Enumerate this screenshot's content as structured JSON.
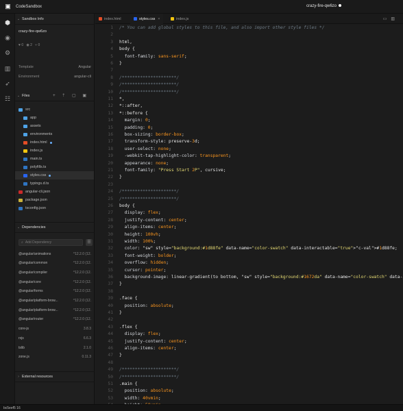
{
  "topbar": {
    "brand": "CodeSandbox",
    "sandbox_name": "crazy-fire-qw6zo"
  },
  "sidebar": {
    "info_header": "Sandbox Info",
    "sandbox_name": "crazy-fire-qw6zo",
    "stats": {
      "likes": "0",
      "views": "2",
      "forks": "0"
    },
    "template_label": "Template",
    "template_value": "Angular",
    "environment_label": "Environment",
    "environment_value": "angular-cli",
    "files_header": "Files",
    "files": [
      {
        "name": "src",
        "type": "folder"
      },
      {
        "name": "app",
        "type": "folder"
      },
      {
        "name": "assets",
        "type": "folder"
      },
      {
        "name": "environments",
        "type": "folder"
      },
      {
        "name": "index.html",
        "type": "html"
      },
      {
        "name": "index.js",
        "type": "js"
      },
      {
        "name": "main.ts",
        "type": "ts"
      },
      {
        "name": "polyfills.ts",
        "type": "ts"
      },
      {
        "name": "styles.css",
        "type": "css"
      },
      {
        "name": "typings.d.ts",
        "type": "ts"
      },
      {
        "name": "angular-cli.json",
        "type": "angular"
      },
      {
        "name": "package.json",
        "type": "json"
      },
      {
        "name": "tsconfig.json",
        "type": "ts"
      }
    ],
    "deps_header": "Dependencies",
    "add_dep_placeholder": "Add Dependency",
    "dependencies": [
      {
        "name": "@angular/animations",
        "version": "^12.2.0 (12."
      },
      {
        "name": "@angular/common",
        "version": "^12.2.0 (12."
      },
      {
        "name": "@angular/compiler",
        "version": "^12.2.0 (12."
      },
      {
        "name": "@angular/core",
        "version": "^12.2.0 (12."
      },
      {
        "name": "@angular/forms",
        "version": "^12.2.0 (12."
      },
      {
        "name": "@angular/platform-brow...",
        "version": "^12.2.0 (12."
      },
      {
        "name": "@angular/platform-brow...",
        "version": "^12.2.0 (12."
      },
      {
        "name": "@angular/router",
        "version": "^12.2.0 (12."
      },
      {
        "name": "core-js",
        "version": "3.8.3"
      },
      {
        "name": "rxjs",
        "version": "6.6.3"
      },
      {
        "name": "tslib",
        "version": "2.1.0"
      },
      {
        "name": "zone.js",
        "version": "0.11.3"
      }
    ],
    "external_header": "External resources"
  },
  "tabs": [
    {
      "label": "index.html",
      "type": "html"
    },
    {
      "label": "styles.css",
      "type": "css"
    },
    {
      "label": "index.js",
      "type": "js"
    }
  ],
  "editor_lines": [
    "/* You can add global styles to this file, and also import other style files */",
    "",
    "html,",
    "body {",
    "  font-family: sans-serif;",
    "}",
    "",
    "/*********************/",
    "/*********************/",
    "/*********************/",
    "*,",
    "*::after,",
    "*::before {",
    "  margin: 0;",
    "  padding: 0;",
    "  box-sizing: border-box;",
    "  transform-style: preserve-3d;",
    "  user-select: none;",
    "  -webkit-tap-highlight-color: transparent;",
    "  appearance: none;",
    "  font-family: \"Press Start 2P\", cursive;",
    "}",
    "",
    "/*********************/",
    "/*********************/",
    "body {",
    "  display: flex;",
    "  justify-content: center;",
    "  align-items: center;",
    "  height: 100vh;",
    "  width: 100%;",
    "  color: #1d88fe;",
    "  font-weight: bolder;",
    "  overflow: hidden;",
    "  cursor: pointer;",
    "  background-image: linear-gradient(to bottom, #1672da, #078dfd, #07b1ff, #00a2ed);",
    "}",
    "",
    ".face {",
    "  position: absolute;",
    "}",
    "",
    ".flex {",
    "  display: flex;",
    "  justify-content: center;",
    "  align-items: center;",
    "}",
    "",
    "/*********************/",
    "/*********************/",
    ".main {",
    "  position: absolute;",
    "  width: 40vmin;",
    "  height: 50vmin;"
  ],
  "status": {
    "left": "bc5eef5 16"
  }
}
